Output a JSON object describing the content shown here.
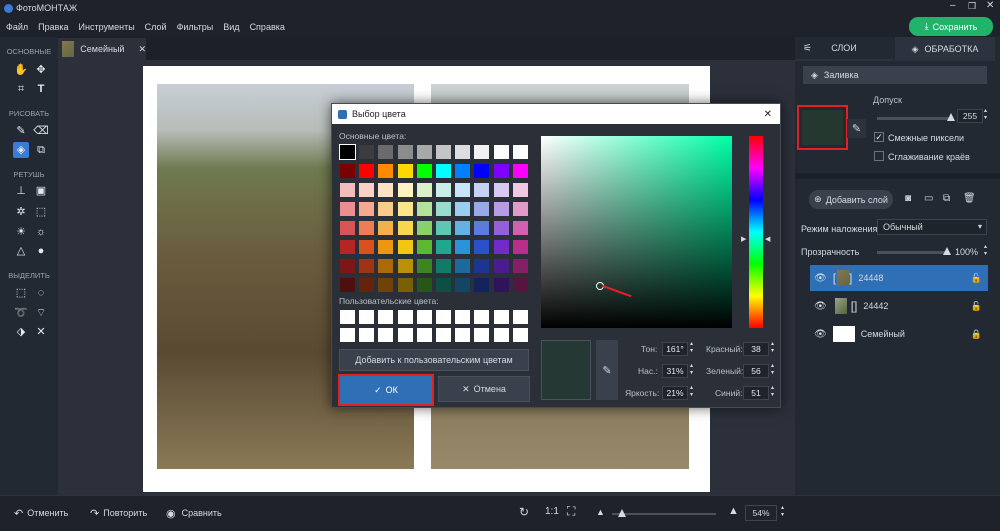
{
  "app": {
    "title": "ФотоМОНТАЖ",
    "save_label": "Сохранить"
  },
  "menu": [
    "Файл",
    "Правка",
    "Инструменты",
    "Слой",
    "Фильтры",
    "Вид",
    "Справка"
  ],
  "document_tab": {
    "label": "Семейный"
  },
  "left_toolbar": {
    "sections": [
      "ОСНОВНЫЕ",
      "РИСОВАТЬ",
      "РЕТУШЬ",
      "ВЫДЕЛИТЬ"
    ]
  },
  "right_panel": {
    "tabs": [
      "СЛОИ",
      "ОБРАБОТКА"
    ],
    "fill_label": "Заливка",
    "tolerance_label": "Допуск",
    "tolerance_value": "255",
    "tolerance_level": 1.0,
    "adjacent_pixels_label": "Смежные пиксели",
    "adjacent_checked": true,
    "smooth_edges_label": "Сглаживание краёв",
    "smooth_checked": false,
    "swatch_color": "#253830",
    "add_layer_label": "Добавить слой",
    "blend_mode_label": "Режим наложения:",
    "blend_mode_value": "Обычный",
    "opacity_label": "Прозрачность",
    "opacity_value": "100%",
    "opacity_level": 1.0,
    "layers": [
      {
        "name": "24448",
        "selected": true
      },
      {
        "name": "24442",
        "selected": false
      },
      {
        "name": "Семейный",
        "selected": false
      }
    ]
  },
  "dialog": {
    "title": "Выбор цвета",
    "basic_colors_label": "Основные цвета:",
    "custom_colors_label": "Пользовательские цвета:",
    "add_custom_label": "Добавить к пользовательским цветам",
    "ok_label": "ОК",
    "cancel_label": "Отмена",
    "hue_label": "Тон:",
    "hue_value": "161°",
    "sat_label": "Нас.:",
    "sat_value": "31%",
    "bright_label": "Яркость:",
    "bright_value": "21%",
    "red_label": "Красный:",
    "red_value": "38",
    "green_label": "Зеленый:",
    "green_value": "56",
    "blue_label": "Синий:",
    "blue_value": "51",
    "preview_color": "#263833",
    "basic_colors": [
      [
        "#000000",
        "#3c3c3c",
        "#6b6b6b",
        "#8c8c8c",
        "#a8a8a8",
        "#c5c5c5",
        "#dedede",
        "#f2f2f2",
        "#ffffff",
        "#ffffff"
      ],
      [
        "#7a0000",
        "#ff0000",
        "#ff8a00",
        "#ffd800",
        "#00ff00",
        "#00ffff",
        "#0080ff",
        "#0000ff",
        "#8000ff",
        "#ff00ff"
      ],
      [
        "#f2bcbc",
        "#fbd0c5",
        "#fde3c4",
        "#fff3c4",
        "#d9f0c8",
        "#c8eee6",
        "#c8e4f7",
        "#c7d1f4",
        "#d8c8f2",
        "#f0c8e4"
      ],
      [
        "#e98f8f",
        "#f5a98f",
        "#f9cc8c",
        "#fce58c",
        "#b3e39a",
        "#99dccf",
        "#9acdef",
        "#98a9ea",
        "#b99ae6",
        "#e29acb"
      ],
      [
        "#d65454",
        "#ee7c54",
        "#f3b14e",
        "#f8d64e",
        "#88d069",
        "#5fc6b3",
        "#63b2e5",
        "#5c7cdd",
        "#955fd7",
        "#d160ae"
      ],
      [
        "#b52525",
        "#d9511c",
        "#ec9612",
        "#f3c614",
        "#5ab833",
        "#20a88f",
        "#2a93d6",
        "#2a51c9",
        "#6f2cc6",
        "#b92d8b"
      ],
      [
        "#7d1616",
        "#9e3410",
        "#ab690a",
        "#b89009",
        "#3c8522",
        "#137a67",
        "#1b6a9c",
        "#1b3591",
        "#4b1c8f",
        "#861f63"
      ],
      [
        "#4f0f0f",
        "#66220a",
        "#6f4307",
        "#786006",
        "#275716",
        "#0c4f43",
        "#124566",
        "#12235e",
        "#31125d",
        "#571441"
      ]
    ]
  }
}
